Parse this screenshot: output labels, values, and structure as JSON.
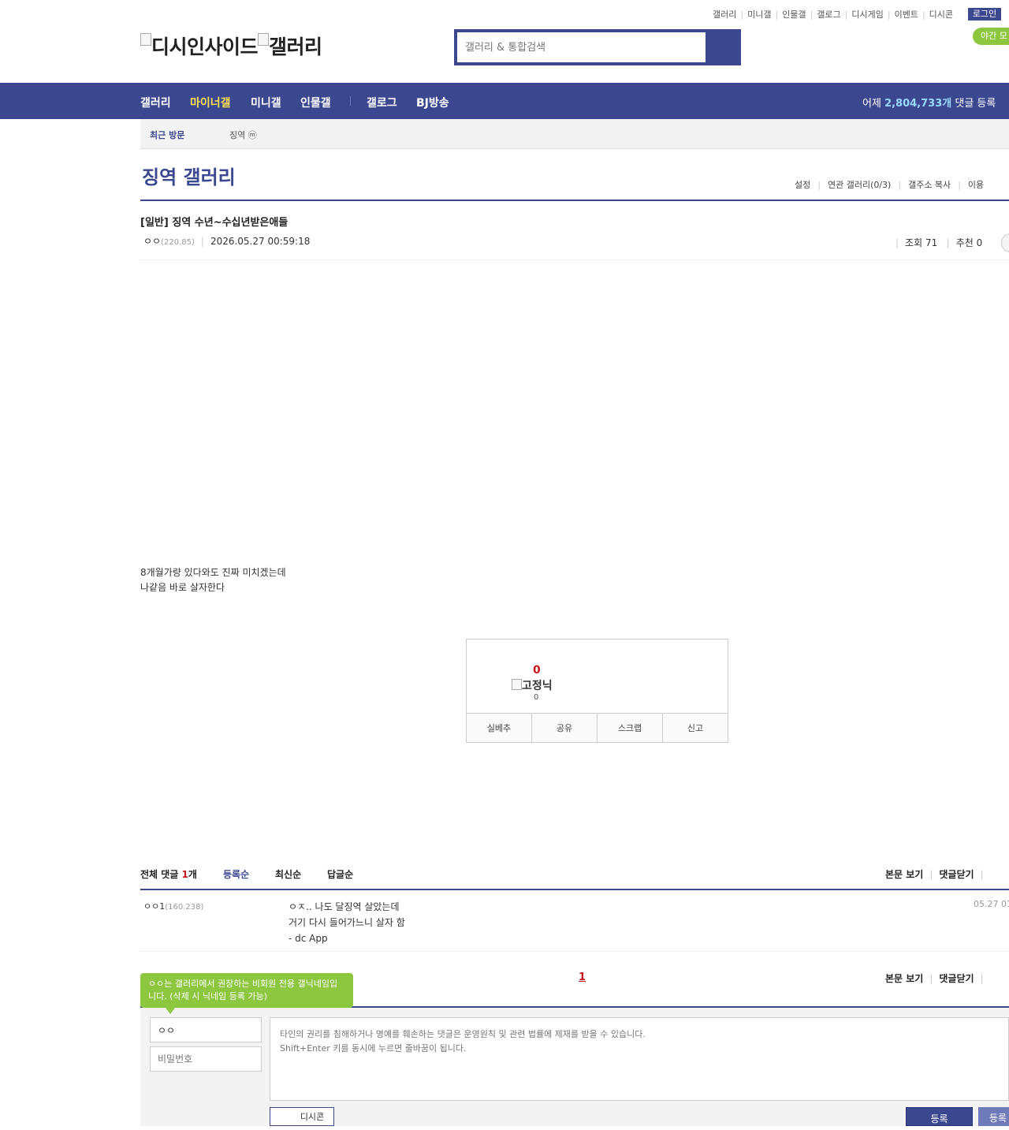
{
  "top_links": [
    "갤러리",
    "미니갤",
    "인물갤",
    "갤로그",
    "디시게임",
    "이벤트",
    "디시콘"
  ],
  "login_label": "로그인",
  "night_mode_label": "야간 모",
  "logo": {
    "site": "디시인사이드",
    "gallery": "갤러리"
  },
  "search": {
    "placeholder": "갤러리 & 통합검색"
  },
  "nav": {
    "items": [
      "갤러리",
      "마이너갤",
      "미니갤",
      "인물갤",
      "갤로그",
      "BJ방송"
    ],
    "active_index": 1,
    "stat_prefix": "어제",
    "stat_value": "2,804,733개",
    "stat_suffix": "댓글 등록"
  },
  "recent": {
    "label": "최근 방문",
    "item": "징역 ⓜ"
  },
  "gallery": {
    "title": "징역 갤러리",
    "links": [
      "설정",
      "연관 갤러리(0/3)",
      "갤주소 복사",
      "이용"
    ]
  },
  "post": {
    "title": "[일반] 징역 수년~수십년받은애들",
    "writer": "ㅇㅇ",
    "writer_ip": "(220.85)",
    "date": "2026.05.27 00:59:18",
    "views_label": "조회 71",
    "recommend_label": "추천 0",
    "body_lines": [
      "8개월가량 있다와도 진짜 미치겠는데",
      "나같음 바로 살자한다"
    ]
  },
  "vote": {
    "count": "0",
    "nickname": "고정닉",
    "sub_count": "0",
    "buttons": [
      "실베추",
      "공유",
      "스크랩",
      "신고"
    ]
  },
  "comments": {
    "header_label": "전체 댓글",
    "count": "1",
    "count_unit": "개",
    "sort_options": [
      "등록순",
      "최신순",
      "답글순"
    ],
    "active_sort_index": 0,
    "right_links": [
      "본문 보기",
      "댓글닫기"
    ],
    "items": [
      {
        "writer": "ㅇㅇ",
        "badge": "1",
        "ip": "(160.238)",
        "lines": [
          "ㅇㅈ.. 나도 달징역 살았는데",
          "거기 다시 들어가느니 살자 함",
          "- dc App"
        ],
        "date": "05.27 01"
      }
    ],
    "page": "1"
  },
  "write": {
    "tooltip": "ㅇㅇ는 갤러리에서 권장하는 비회원 전용 갤닉네임입니다. (삭제 시 닉네임 등록 가능)",
    "nickname_value": "ㅇㅇ",
    "password_placeholder": "비밀번호",
    "textarea_placeholder": "타인의 권리를 침해하거나 명예를 훼손하는 댓글은 운영원칙 및 관련 법률에 제재를 받을 수 있습니다.\nShift+Enter 키를 동시에 누르면 줄바꿈이 됩니다.",
    "dccon_label": "디시콘",
    "submit_label": "등록",
    "submit2_label": "등록"
  },
  "colors": {
    "brand": "#3b4890",
    "accent_green": "#8dc63f",
    "alert_red": "#c4161c",
    "nav_active": "#ffe24d"
  }
}
